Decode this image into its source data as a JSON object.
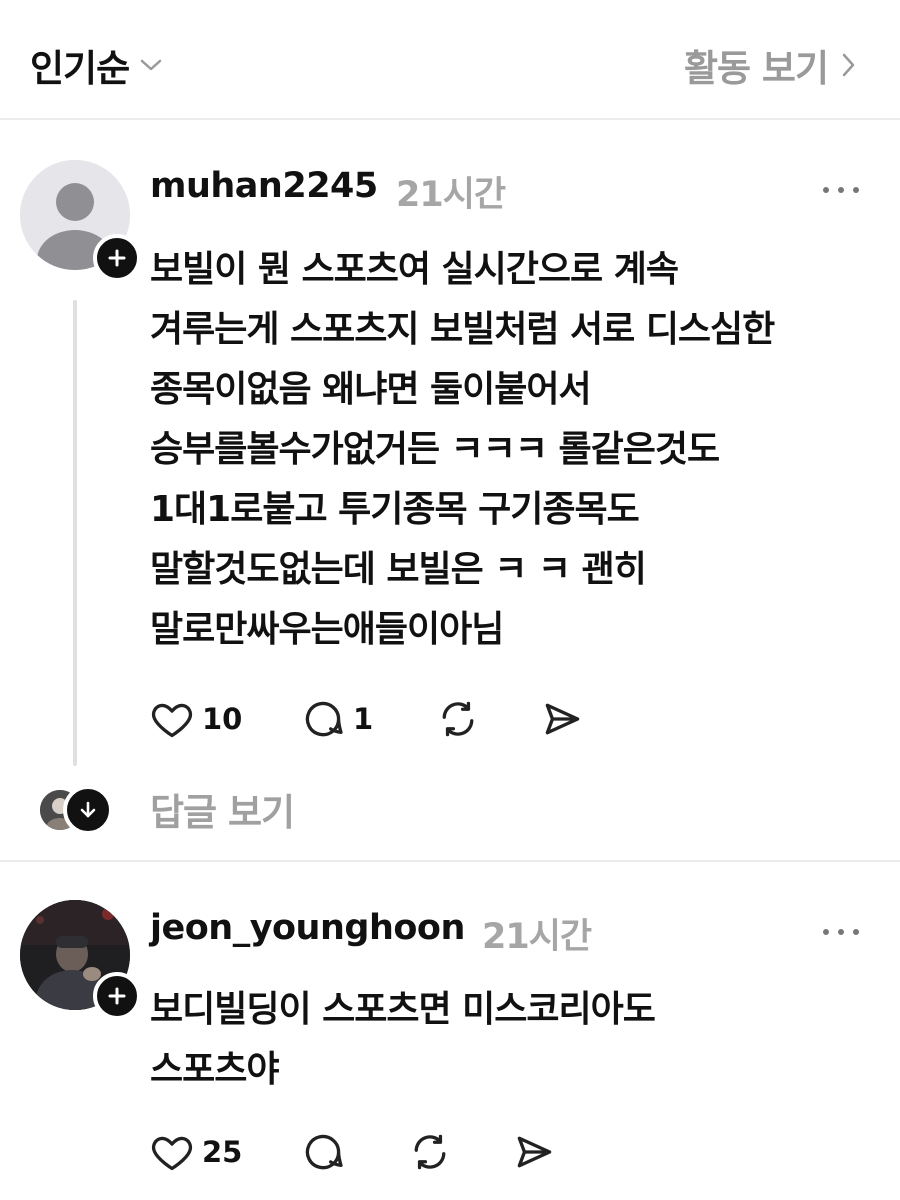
{
  "header": {
    "sort_label": "인기순",
    "activity_label": "활동 보기"
  },
  "posts": [
    {
      "username": "muhan2245",
      "time": "21시간",
      "lines": [
        "보빌이 뭔 스포츠여 실시간으로 계속",
        "겨루는게 스포츠지  보빌처럼 서로 디스심한",
        "종목이없음 왜냐면 둘이붙어서",
        "승부를볼수가없거든 ㅋㅋㅋ 롤같은것도",
        "1대1로붙고 투기종목 구기종목도",
        "말할것도없는데 보빌은 ㅋ ㅋ 괜히",
        "말로만싸우는애들이아님"
      ],
      "likes": "10",
      "comments": "1",
      "view_replies": "답글 보기"
    },
    {
      "username": "jeon_younghoon",
      "time": "21시간",
      "lines": [
        "보디빌딩이 스포츠면 미스코리아도",
        "스포츠야"
      ],
      "likes": "25"
    }
  ]
}
